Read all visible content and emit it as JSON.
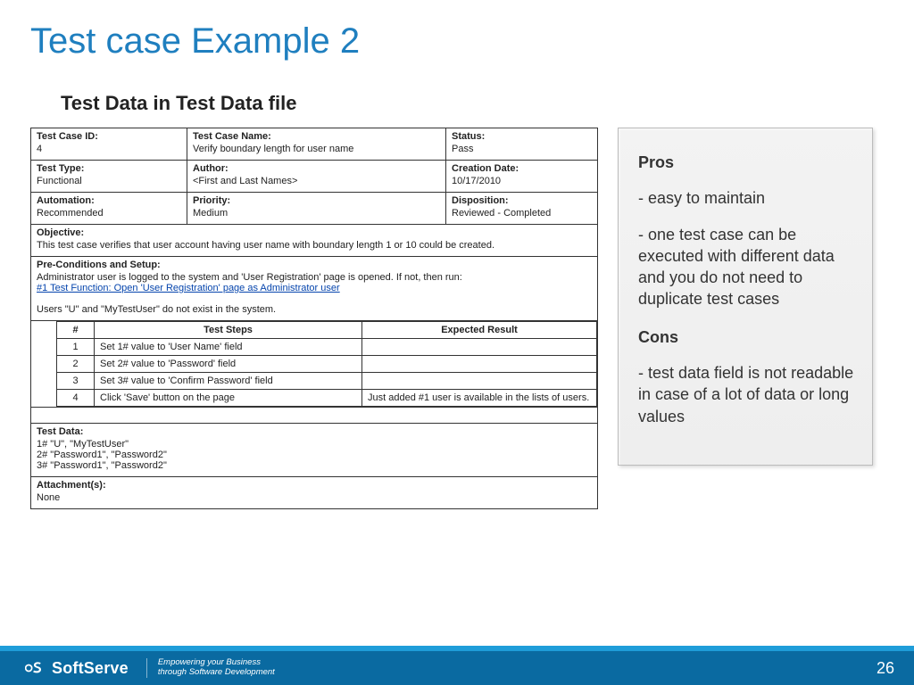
{
  "title": "Test case Example 2",
  "subtitle": "Test Data in Test Data file",
  "tc": {
    "id_label": "Test Case ID:",
    "id_value": "4",
    "name_label": "Test Case Name:",
    "name_value": "Verify boundary length for user name",
    "status_label": "Status:",
    "status_value": "Pass",
    "type_label": "Test Type:",
    "type_value": "Functional",
    "author_label": "Author:",
    "author_value": "<First and Last Names>",
    "cdate_label": "Creation Date:",
    "cdate_value": "10/17/2010",
    "auto_label": "Automation:",
    "auto_value": "Recommended",
    "prio_label": "Priority:",
    "prio_value": "Medium",
    "disp_label": "Disposition:",
    "disp_value": "Reviewed - Completed",
    "obj_label": "Objective:",
    "obj_value": "This test case verifies that user account having user name with boundary length 1 or 10 could be created.",
    "pre_label": "Pre-Conditions and Setup:",
    "pre_line1": "Administrator user is logged to the system and 'User Registration' page is opened. If not, then run:",
    "pre_link": "#1 Test Function: Open 'User Registration' page as Administrator user",
    "pre_line2": "Users \"U\" and \"MyTestUser\" do not exist in the system.",
    "steps_header_num": "#",
    "steps_header_steps": "Test Steps",
    "steps_header_result": "Expected Result",
    "steps": [
      {
        "n": "1",
        "step": "Set 1# value to 'User Name' field",
        "result": ""
      },
      {
        "n": "2",
        "step": "Set 2# value to 'Password' field",
        "result": ""
      },
      {
        "n": "3",
        "step": "Set 3# value to 'Confirm Password' field",
        "result": ""
      },
      {
        "n": "4",
        "step": "Click 'Save' button on the page",
        "result": "Just added #1 user is available in the lists of users."
      }
    ],
    "testdata_label": "Test Data:",
    "testdata_l1": "1# \"U\", \"MyTestUser\"",
    "testdata_l2": "2# \"Password1\", \"Password2\"",
    "testdata_l3": "3# \"Password1\", \"Password2\"",
    "attach_label": "Attachment(s):",
    "attach_value": "None"
  },
  "sidebar": {
    "pros_h": "Pros",
    "pros_1": "- easy to maintain",
    "pros_2": "- one test case can be executed with different data and you do not need to duplicate test cases",
    "cons_h": "Cons",
    "cons_1": "- test data field is not readable in case of a lot of data or long values"
  },
  "footer": {
    "brand": "SoftServe",
    "tag1": "Empowering your Business",
    "tag2": "through Software Development",
    "page": "26"
  }
}
